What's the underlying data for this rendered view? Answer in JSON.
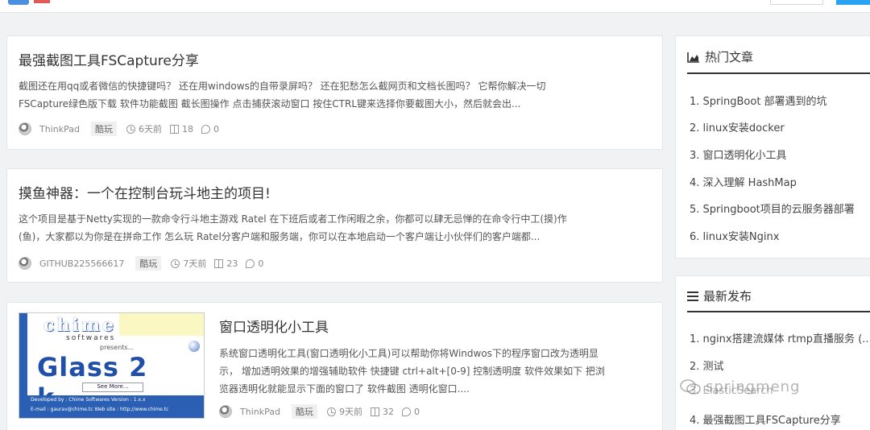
{
  "articles": [
    {
      "title": "最强截图工具FSCapture分享",
      "excerpt_line1": "截图还在用qq或者微信的快捷键吗？ 还在用windows的自带录屏吗？ 还在犯愁怎么截网页和文档长图吗？ 它帮你解决一切",
      "excerpt_line2": "FSCapture绿色版下载 软件功能截图 截长图操作 点击捕获滚动窗口 按住CTRL键来选择你要截图大小，然后就会出...",
      "author": "ThinkPad",
      "tag": "酷玩",
      "time": "6天前",
      "views": "18",
      "comments": "0"
    },
    {
      "title": "摸鱼神器：一个在控制台玩斗地主的项目!",
      "excerpt_line1": "这个项目是基于Netty实现的一款命令行斗地主游戏 Ratel 在下班后或者工作闲暇之余，你都可以肆无忌惮的在命令行中工(摸)作",
      "excerpt_line2": "(鱼)，大家都以为你是在拼命工作 怎么玩 Ratel分客户端和服务端，你可以在本地启动一个客户端让小伙伴们的客户端都...",
      "author": "GITHUB225566617",
      "tag": "酷玩",
      "time": "7天前",
      "views": "23",
      "comments": "0"
    },
    {
      "title": "窗口透明化小工具",
      "excerpt_line1": "系统窗口透明化工具(窗口透明化小工具)可以帮助你将Windwos下的程序窗口改为透明显",
      "excerpt_line2": "示，  增加透明效果的增强辅助软件 快捷键 ctrl+alt+[0-9] 控制透明度 软件效果如下 把浏",
      "excerpt_line3": "览器透明化就能显示下面的窗口了 软件截图 透明化窗口....",
      "author": "ThinkPad",
      "tag": "酷玩",
      "time": "9天前",
      "views": "32",
      "comments": "0",
      "thumb": {
        "brand": "chime",
        "sub": "softwares",
        "presents": "presents...",
        "product": "Glass 2 k...",
        "see_more": "See More...",
        "line1": "Developed by : Chime Softwares          Version : 1.x.x",
        "line2": "E-mail : gaurav@chime.tc     Web site : http://www.chime.tc"
      }
    }
  ],
  "hot": {
    "title": "热门文章",
    "icon": "area-chart-icon",
    "items": [
      "1. SpringBoot 部署遇到的坑",
      "2. linux安装docker",
      "3. 窗口透明化小工具",
      "4. 深入理解 HashMap",
      "5. Springboot项目的云服务器部署",
      "6. linux安装Nginx"
    ]
  },
  "latest": {
    "title": "最新发布",
    "icon": "list-icon",
    "items": [
      "1. nginx搭建流媒体 rtmp直播服务 (...",
      "2. 测试",
      "3. ElasticSearch",
      "4. 最强截图工具FSCapture分享"
    ]
  },
  "watermark": "springmeng",
  "colors": {
    "topbar_button": "#29a3f2",
    "thumb_blue": "#2b5fb3"
  }
}
